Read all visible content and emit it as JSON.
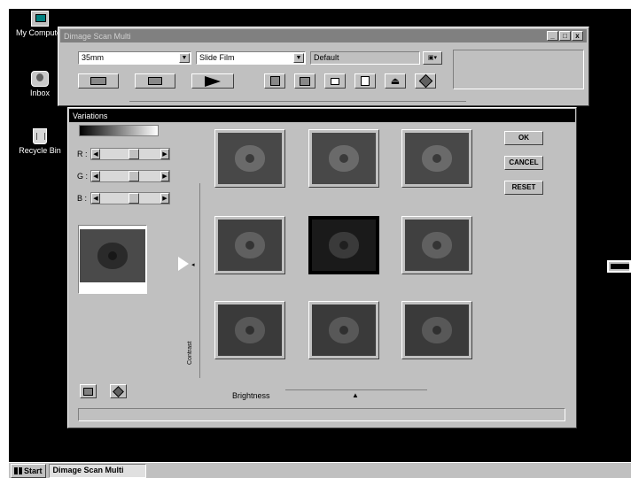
{
  "desktop": {
    "icons": [
      {
        "label": "My Computer",
        "icon": "computer-icon"
      },
      {
        "label": "Inbox",
        "icon": "inbox-icon"
      },
      {
        "label": "Recycle Bin",
        "icon": "recycle-bin-icon"
      }
    ]
  },
  "main_window": {
    "title": "Dimage Scan Multi",
    "film_format": "35mm",
    "film_type": "Slide Film",
    "profile": "Default",
    "window_buttons": [
      "_",
      "□",
      "x"
    ],
    "toolbar_icons": [
      "index-scan-icon",
      "prescan-icon",
      "scan-icon",
      "crop-icon",
      "image-correction-icon",
      "rotate-icon",
      "preferences-icon",
      "eject-icon",
      "help-icon"
    ]
  },
  "variations_window": {
    "title": "Variations",
    "channels": [
      {
        "label": "R :",
        "value": 0.5
      },
      {
        "label": "G :",
        "value": 0.5
      },
      {
        "label": "B :",
        "value": 0.5
      }
    ],
    "buttons": {
      "ok": "OK",
      "cancel": "CANCEL",
      "reset": "RESET"
    },
    "contrast_label": "Contrast",
    "brightness_label": "Brightness",
    "grid": [
      {
        "tint": "#6a6a6a"
      },
      {
        "tint": "#6a6a6a"
      },
      {
        "tint": "#6a6a6a"
      },
      {
        "tint": "#606060"
      },
      {
        "tint": "#3a3a3a"
      },
      {
        "tint": "#606060"
      },
      {
        "tint": "#585858"
      },
      {
        "tint": "#585858"
      },
      {
        "tint": "#585858"
      }
    ],
    "selected_index": 4
  },
  "taskbar": {
    "start_label": "Start",
    "task_label": "Dimage Scan Multi"
  }
}
